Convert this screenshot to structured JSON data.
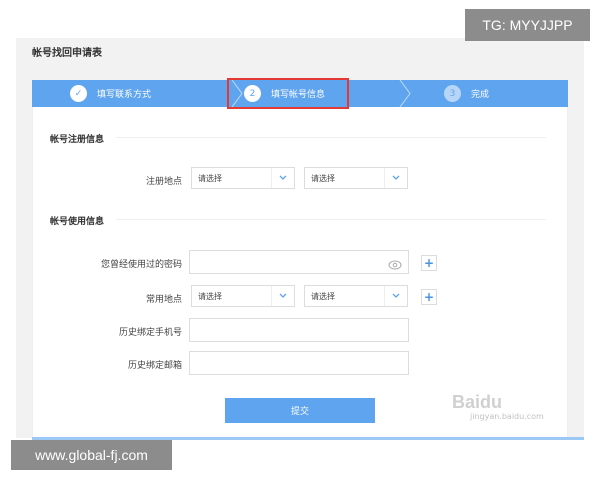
{
  "page": {
    "title": "帐号找回申请表"
  },
  "stepper": {
    "steps": [
      {
        "number": "✓",
        "label": "填写联系方式",
        "state": "done"
      },
      {
        "number": "2",
        "label": "填写帐号信息",
        "state": "active"
      },
      {
        "number": "3",
        "label": "完成",
        "state": "pending"
      }
    ],
    "highlighted_step": 2
  },
  "registration": {
    "section_title": "帐号注册信息",
    "location_label": "注册地点",
    "select_1_value": "请选择",
    "select_2_value": "请选择"
  },
  "usage": {
    "section_title": "帐号使用信息",
    "password_label": "您曾经使用过的密码",
    "password_value": "",
    "common_location_label": "常用地点",
    "common_select_1_value": "请选择",
    "common_select_2_value": "请选择",
    "phone_label": "历史绑定手机号",
    "phone_value": "",
    "email_label": "历史绑定邮箱",
    "email_value": ""
  },
  "actions": {
    "submit_label": "提交",
    "add_symbol": "+"
  },
  "watermarks": {
    "baidu": "Baidu",
    "jingyan": "jingyan.baidu.com",
    "top_right": "TG: MYYJJPP",
    "bottom_left": "www.global-fj.com"
  },
  "colors": {
    "accent": "#5fa4ee",
    "highlight": "#e53935",
    "tag_bg": "#8c8c8c"
  }
}
